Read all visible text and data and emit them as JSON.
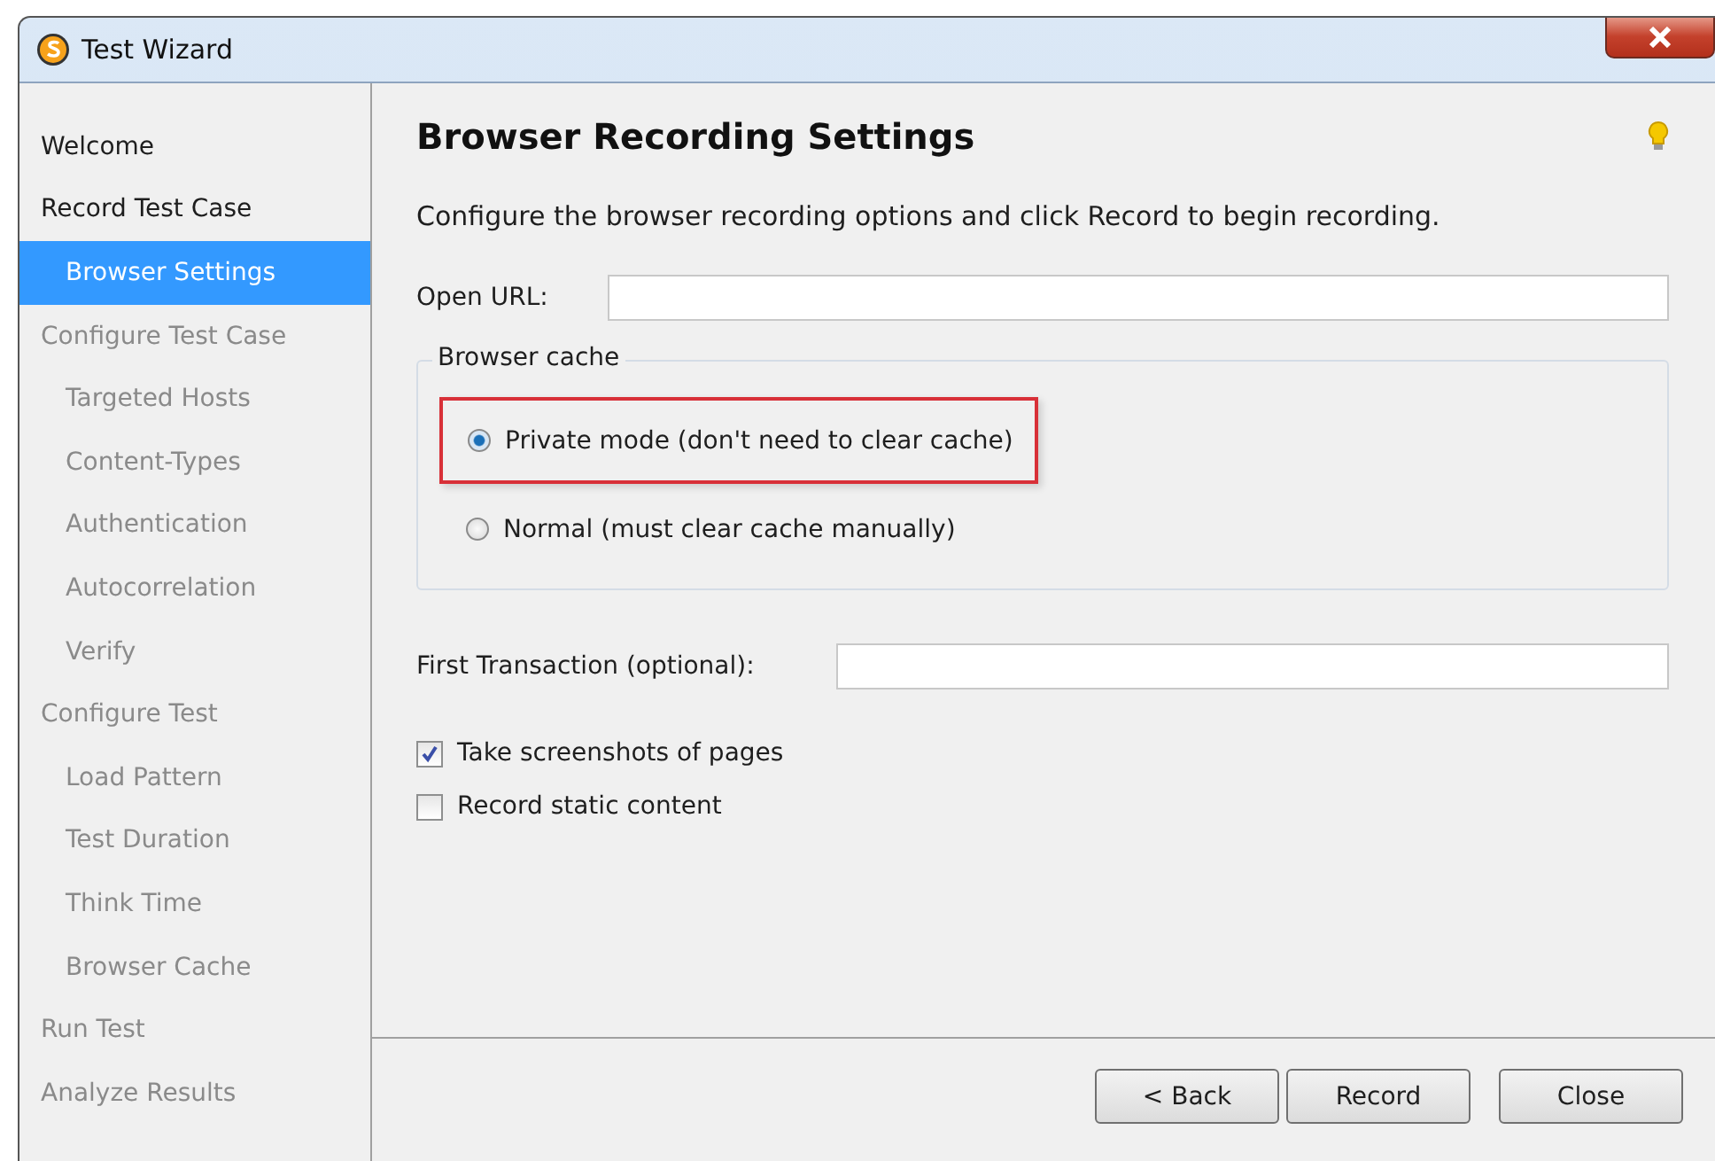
{
  "window": {
    "title": "Test Wizard"
  },
  "sidebar": {
    "items": [
      {
        "label": "Welcome",
        "selected": false,
        "disabled": false
      },
      {
        "label": "Record Test Case",
        "selected": false,
        "disabled": false,
        "children": [
          {
            "label": "Browser Settings",
            "selected": true,
            "disabled": false
          }
        ]
      },
      {
        "label": "Configure Test Case",
        "selected": false,
        "disabled": true,
        "children": [
          {
            "label": "Targeted Hosts",
            "selected": false,
            "disabled": true
          },
          {
            "label": "Content-Types",
            "selected": false,
            "disabled": true
          },
          {
            "label": "Authentication",
            "selected": false,
            "disabled": true
          },
          {
            "label": "Autocorrelation",
            "selected": false,
            "disabled": true
          },
          {
            "label": "Verify",
            "selected": false,
            "disabled": true
          }
        ]
      },
      {
        "label": "Configure Test",
        "selected": false,
        "disabled": true,
        "children": [
          {
            "label": "Load Pattern",
            "selected": false,
            "disabled": true
          },
          {
            "label": "Test Duration",
            "selected": false,
            "disabled": true
          },
          {
            "label": "Think Time",
            "selected": false,
            "disabled": true
          },
          {
            "label": "Browser Cache",
            "selected": false,
            "disabled": true
          }
        ]
      },
      {
        "label": "Run Test",
        "selected": false,
        "disabled": true
      },
      {
        "label": "Analyze Results",
        "selected": false,
        "disabled": true
      }
    ]
  },
  "page": {
    "heading": "Browser Recording Settings",
    "intro": "Configure the browser recording options and click Record to begin recording.",
    "open_url": {
      "label": "Open URL:"
    },
    "browser_cache": {
      "title": "Browser cache",
      "options": [
        {
          "label": "Private mode (don't need to clear cache)",
          "selected": true
        },
        {
          "label": "Normal (must clear cache manually)",
          "selected": false
        }
      ]
    },
    "first_transaction": {
      "label": "First Transaction (optional):"
    },
    "checkboxes": [
      {
        "label": "Take screenshots of pages",
        "checked": true
      },
      {
        "label": "Record static content",
        "checked": false
      }
    ]
  },
  "buttons": [
    "< Back",
    "Record",
    "Close"
  ]
}
